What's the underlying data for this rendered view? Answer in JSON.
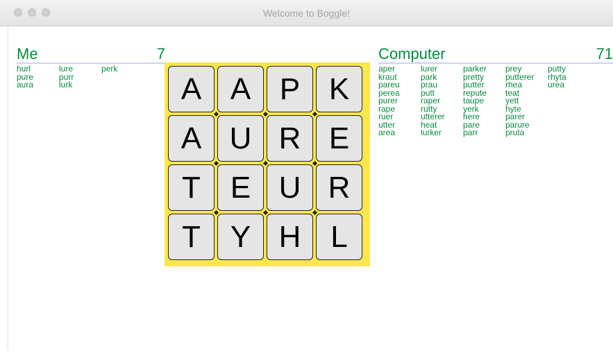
{
  "window": {
    "title": "Welcome to Boggle!"
  },
  "me": {
    "label": "Me",
    "score": "7",
    "words": [
      "hurl",
      "pure",
      "aura",
      "lure",
      "purr",
      "lurk",
      "perk"
    ]
  },
  "computer": {
    "label": "Computer",
    "score": "71",
    "words": [
      "aper",
      "kraut",
      "pareu",
      "perea",
      "purer",
      "rape",
      "ruer",
      "utter",
      "area",
      "lurer",
      "park",
      "prau",
      "putt",
      "raper",
      "rutty",
      "utterer",
      "heat",
      "lurker",
      "parker",
      "pretty",
      "putter",
      "repute",
      "taupe",
      "yerk",
      "here",
      "pare",
      "parr",
      "prey",
      "putterer",
      "rhea",
      "teat",
      "yett",
      "hyte",
      "parer",
      "parure",
      "pruta",
      "putty",
      "rhyta",
      "urea"
    ]
  },
  "board": {
    "rows": [
      [
        "A",
        "A",
        "P",
        "K"
      ],
      [
        "A",
        "U",
        "R",
        "E"
      ],
      [
        "T",
        "E",
        "U",
        "R"
      ],
      [
        "T",
        "Y",
        "H",
        "L"
      ]
    ]
  },
  "colors": {
    "accent": "#048c3e",
    "board": "#fde74c",
    "tile": "#e5e5e5",
    "underline": "#cdd0ff"
  }
}
